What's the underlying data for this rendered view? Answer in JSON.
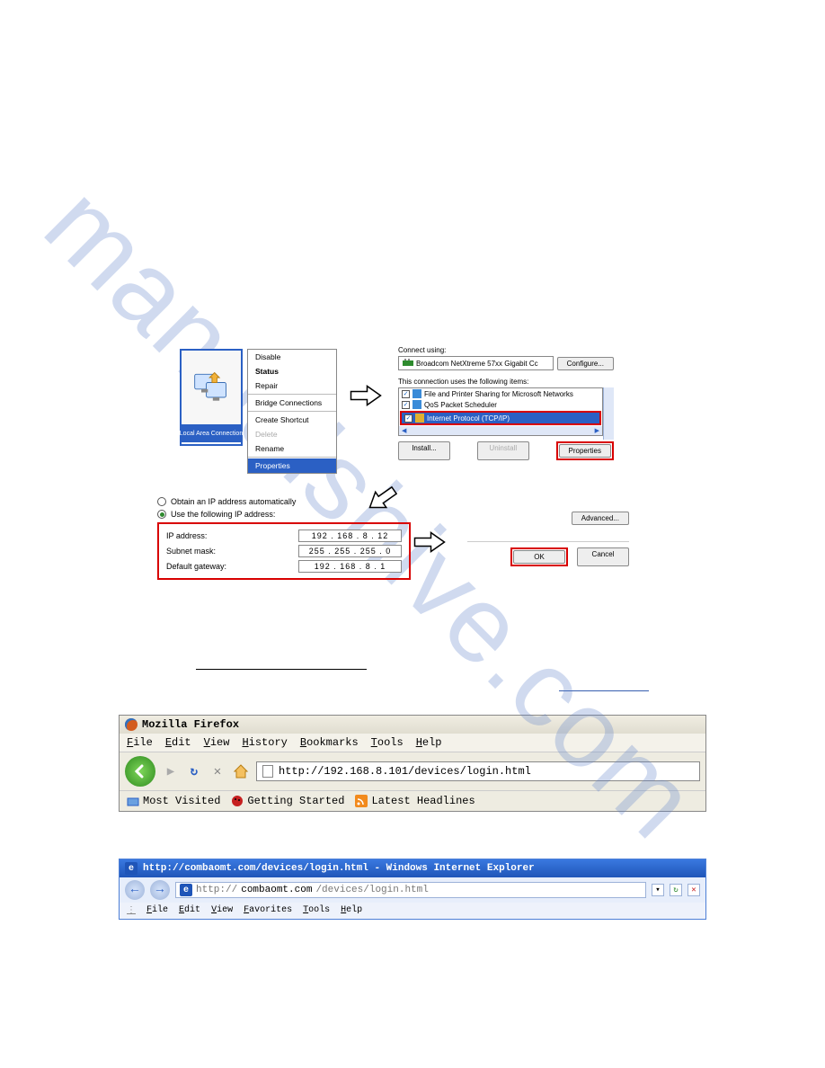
{
  "lac_caption": "Local Area Connection",
  "ctx": {
    "disable": "Disable",
    "status": "Status",
    "repair": "Repair",
    "bridge": "Bridge Connections",
    "shortcut": "Create Shortcut",
    "delete": "Delete",
    "rename": "Rename",
    "properties": "Properties"
  },
  "conn": {
    "connect_using": "Connect using:",
    "adapter": "Broadcom NetXtreme 57xx Gigabit Cc",
    "configure": "Configure...",
    "uses_items": "This connection uses the following items:",
    "item_fp": "File and Printer Sharing for Microsoft Networks",
    "item_qos": "QoS Packet Scheduler",
    "item_tcpip": "Internet Protocol (TCP/IP)",
    "install": "Install...",
    "uninstall": "Uninstall",
    "properties": "Properties"
  },
  "ipopt": {
    "auto": "Obtain an IP address automatically",
    "manual": "Use the following IP address:",
    "ip_lbl": "IP address:",
    "ip_val": "192 . 168 .  8  .  12",
    "mask_lbl": "Subnet mask:",
    "mask_val": "255 . 255 . 255 .  0",
    "gw_lbl": "Default gateway:",
    "gw_val": "192 . 168 .  8  .  1"
  },
  "okc": {
    "advanced": "Advanced...",
    "ok": "OK",
    "cancel": "Cancel"
  },
  "ff": {
    "title": "Mozilla Firefox",
    "menu": [
      "File",
      "Edit",
      "View",
      "History",
      "Bookmarks",
      "Tools",
      "Help"
    ],
    "url": "http://192.168.8.101/devices/login.html",
    "bk1": "Most Visited",
    "bk2": "Getting Started",
    "bk3": "Latest Headlines"
  },
  "ie": {
    "title": "http://combaomt.com/devices/login.html - Windows Internet Explorer",
    "url_prefix": "http://",
    "url_host": "combaomt.com",
    "url_rest": "/devices/login.html",
    "menu": [
      "File",
      "Edit",
      "View",
      "Favorites",
      "Tools",
      "Help"
    ]
  }
}
